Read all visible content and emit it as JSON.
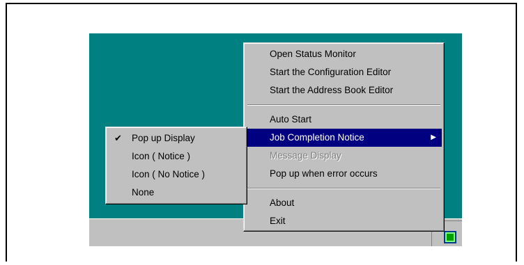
{
  "main_menu": {
    "items": [
      {
        "label": "Open Status Monitor"
      },
      {
        "label": "Start the Configuration Editor"
      },
      {
        "label": "Start the Address Book Editor"
      },
      {
        "label": "Auto Start"
      },
      {
        "label": "Job Completion Notice"
      },
      {
        "label": "Message Display"
      },
      {
        "label": "Pop up when error occurs"
      },
      {
        "label": "About"
      },
      {
        "label": "Exit"
      }
    ],
    "submenu_arrow": "▶"
  },
  "sub_menu": {
    "items": [
      {
        "label": "Pop up Display",
        "checked": true
      },
      {
        "label": "Icon ( Notice )"
      },
      {
        "label": "Icon ( No Notice )"
      },
      {
        "label": "None"
      }
    ],
    "check_glyph": "✔"
  },
  "tray": {
    "icon": "printer-status-icon"
  },
  "colors": {
    "desktop": "#008080",
    "menu_bg": "#c0c0c0",
    "highlight": "#000080",
    "disabled_text": "#808080",
    "tray_icon": "#00a000"
  }
}
